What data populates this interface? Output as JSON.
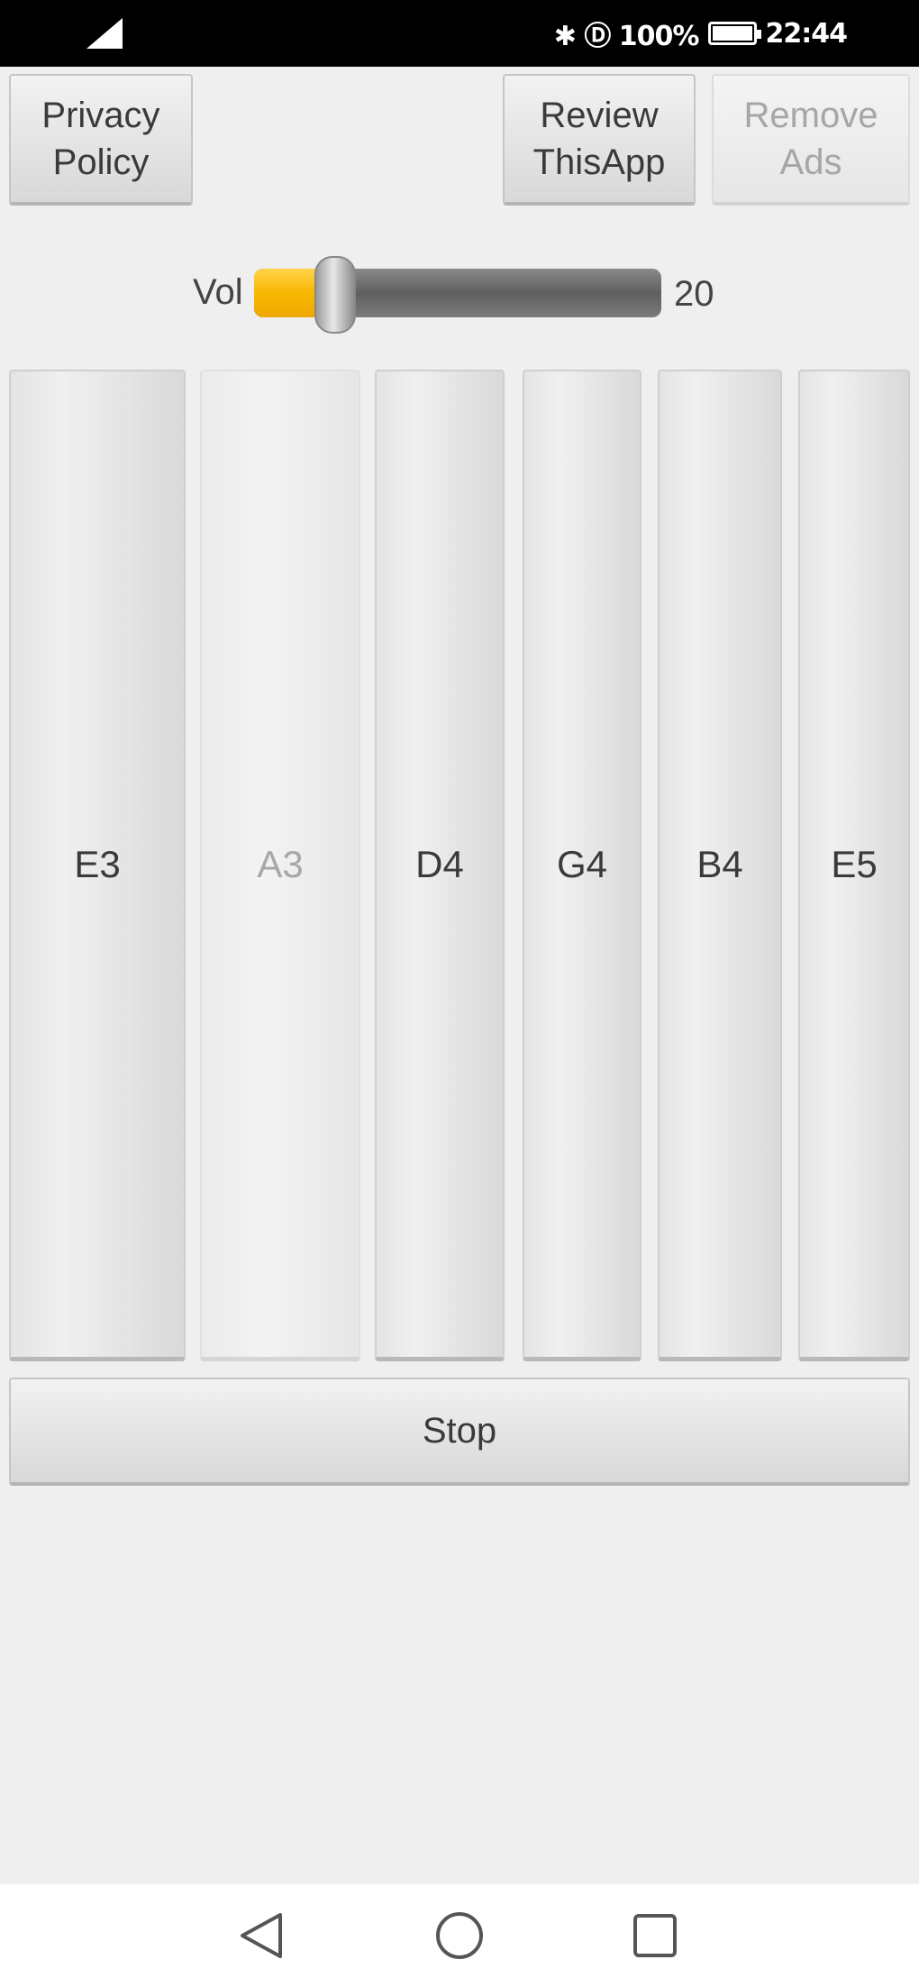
{
  "status_bar": {
    "indicators": "✱ Ⓓ 100%",
    "time": "22:44",
    "icons": [
      "signal-icon",
      "bluetooth-icon",
      "battery-icon"
    ]
  },
  "top_buttons": {
    "privacy_policy": "Privacy\nPolicy",
    "review_app": "Review\nThisApp",
    "remove_ads": "Remove\nAds"
  },
  "volume": {
    "label": "Vol",
    "value": "20",
    "level_fraction": 0.2,
    "fill_color": "#f7b800"
  },
  "strings": [
    {
      "label": "E3",
      "enabled": true
    },
    {
      "label": "A3",
      "enabled": false
    },
    {
      "label": "D4",
      "enabled": true
    },
    {
      "label": "G4",
      "enabled": true
    },
    {
      "label": "B4",
      "enabled": true
    },
    {
      "label": "E5",
      "enabled": true
    }
  ],
  "stop_button": {
    "label": "Stop"
  },
  "nav_bar": {
    "icons": [
      "back-icon",
      "home-icon",
      "recents-icon"
    ]
  }
}
